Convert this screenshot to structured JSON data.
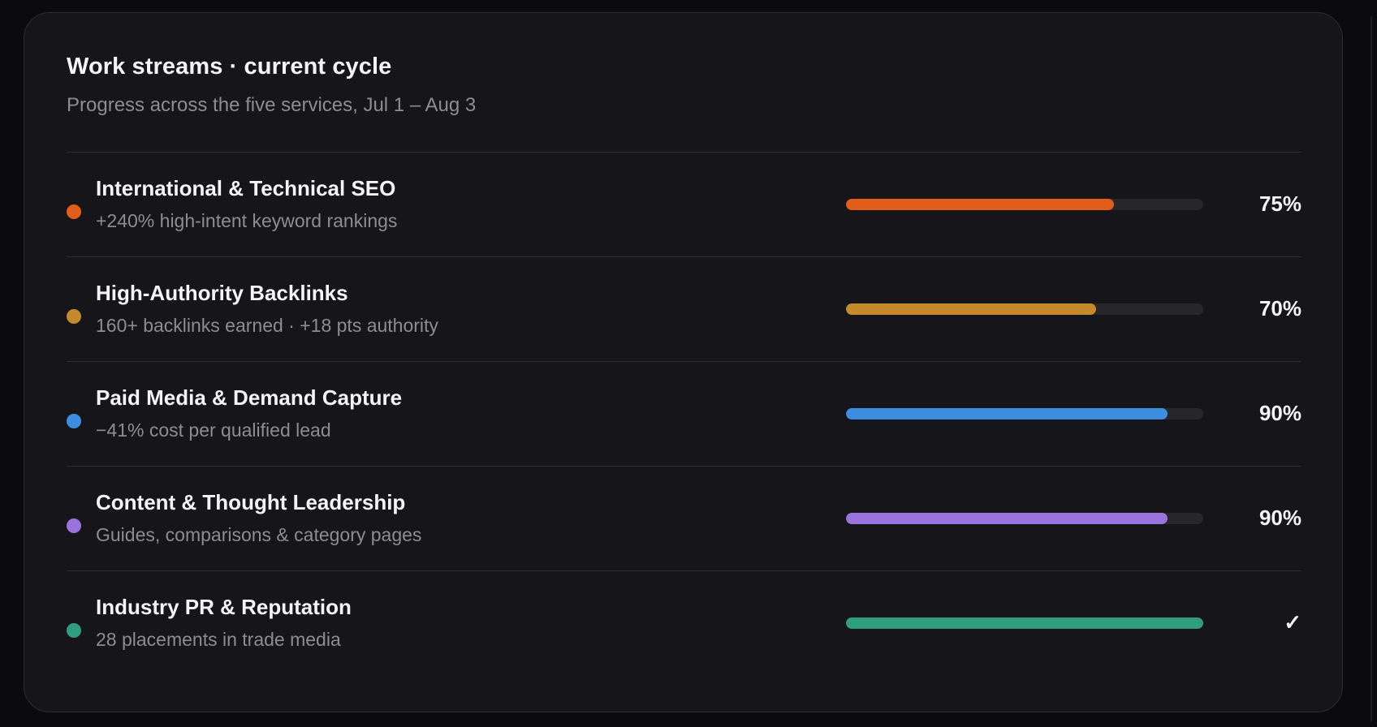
{
  "card": {
    "title": "Work streams · current cycle",
    "subtitle": "Progress across the five services, Jul 1 – Aug 3"
  },
  "streams": [
    {
      "name": "International & Technical SEO",
      "detail": "+240% high-intent keyword rankings",
      "progress": 0.75,
      "value_label": "75%",
      "color": "#e35d1a"
    },
    {
      "name": "High-Authority Backlinks",
      "detail": "160+ backlinks earned · +18 pts authority",
      "progress": 0.7,
      "value_label": "70%",
      "color": "#c48a2c"
    },
    {
      "name": "Paid Media & Demand Capture",
      "detail": "−41% cost per qualified lead",
      "progress": 0.9,
      "value_label": "90%",
      "color": "#3b8ee0"
    },
    {
      "name": "Content & Thought Leadership",
      "detail": "Guides, comparisons & category pages",
      "progress": 0.9,
      "value_label": "90%",
      "color": "#9b73dc"
    },
    {
      "name": "Industry PR & Reputation",
      "detail": "28 placements in trade media",
      "progress": 1.0,
      "value_label": "✓",
      "color": "#2f9e7e"
    }
  ]
}
